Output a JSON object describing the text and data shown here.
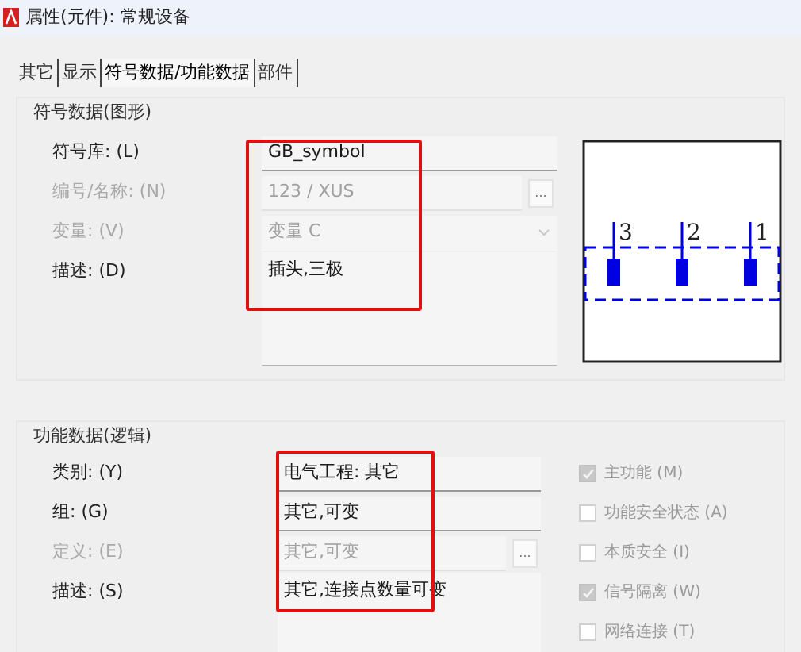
{
  "window": {
    "title": "属性(元件): 常规设备"
  },
  "tabs": [
    {
      "label": "其它",
      "selected": false
    },
    {
      "label": "显示",
      "selected": false
    },
    {
      "label": "符号数据/功能数据",
      "selected": true
    },
    {
      "label": "部件",
      "selected": false
    }
  ],
  "symbol_group": {
    "title": "符号数据(图形)",
    "fields": [
      {
        "label": "符号库: (L)",
        "value": "GB_symbol",
        "disabled": false,
        "kind": "text"
      },
      {
        "label": "编号/名称: (N)",
        "value": "123 / XUS",
        "disabled": true,
        "kind": "browse",
        "button": "..."
      },
      {
        "label": "变量: (V)",
        "value": "变量 C",
        "disabled": true,
        "kind": "dropdown"
      },
      {
        "label": "描述: (D)",
        "value": "插头,三极",
        "disabled": false,
        "kind": "multiline"
      }
    ],
    "preview": {
      "pins": [
        "3",
        "2",
        "1"
      ]
    }
  },
  "function_group": {
    "title": "功能数据(逻辑)",
    "fields": [
      {
        "label": "类别: (Y)",
        "value": "电气工程: 其它",
        "disabled": false,
        "kind": "text"
      },
      {
        "label": "组: (G)",
        "value": "其它,可变",
        "disabled": false,
        "kind": "text"
      },
      {
        "label": "定义: (E)",
        "value": "其它,可变",
        "disabled": true,
        "kind": "browse",
        "button": "..."
      },
      {
        "label": "描述: (S)",
        "value": "其它,连接点数量可变",
        "disabled": false,
        "kind": "multiline"
      }
    ],
    "options": [
      {
        "label": "主功能 (M)",
        "checked": true
      },
      {
        "label": "功能安全状态 (A)",
        "checked": false
      },
      {
        "label": "本质安全 (I)",
        "checked": false
      },
      {
        "label": "信号隔离 (W)",
        "checked": true
      },
      {
        "label": "网络连接 (T)",
        "checked": false
      }
    ]
  }
}
